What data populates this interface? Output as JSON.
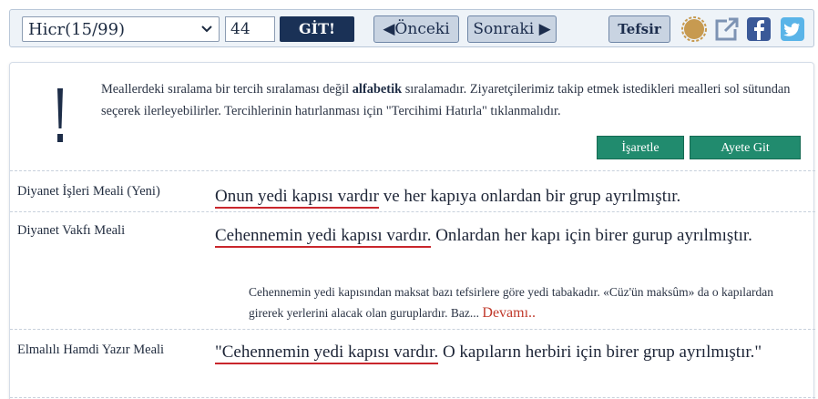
{
  "toolbar": {
    "surah_select_value": "Hicr(15/99)",
    "ayah_input_value": "44",
    "go_label": "GİT!",
    "prev_label": "◀Önceki",
    "next_label": "Sonraki ▶",
    "tafsir_label": "Tefsir",
    "icons": [
      "badge-icon",
      "external-link-icon",
      "facebook-icon",
      "twitter-icon"
    ]
  },
  "notice": {
    "text_before": "Meallerdeki sıralama bir tercih sıralaması değil ",
    "text_bold": "alfabetik",
    "text_after": " sıralamadır. Ziyaretçilerimiz takip etmek istedikleri mealleri sol sütundan seçerek ilerleyebilirler. Tercihlerinin hatırlanması için \"Tercihimi Hatırla\" tıklanmalıdır.",
    "mark_label": "İşaretle",
    "goto_label": "Ayete Git"
  },
  "translations": [
    {
      "name": "Diyanet İşleri Meali (Yeni)",
      "highlight": "Onun yedi kapısı vardır",
      "rest": " ve her kapıya onlardan bir grup ayrılmıştır."
    },
    {
      "name": "Diyanet Vakfı Meali",
      "highlight": "Cehennemin yedi kapısı vardır.",
      "rest": " Onlardan her kapı için birer gurup ayrılmıştır.",
      "note": "Cehennemin yedi kapısından maksat bazı tefsirlere göre yedi tabakadır. «Cüz'ün maksûm» da o kapılardan girerek yerlerini alacak olan guruplardır. Baz...",
      "more_label": "Devamı.."
    },
    {
      "name": "Elmalılı Hamdi Yazır Meali",
      "highlight": "\"Cehennemin yedi kapısı vardır.",
      "rest": " O kapıların herbiri için birer grup ayrılmıştır.\""
    }
  ],
  "colors": {
    "go_button": "#1a3156",
    "green_button": "#218b6e",
    "highlight_underline": "#c9262c",
    "more_link": "#c0392b"
  }
}
